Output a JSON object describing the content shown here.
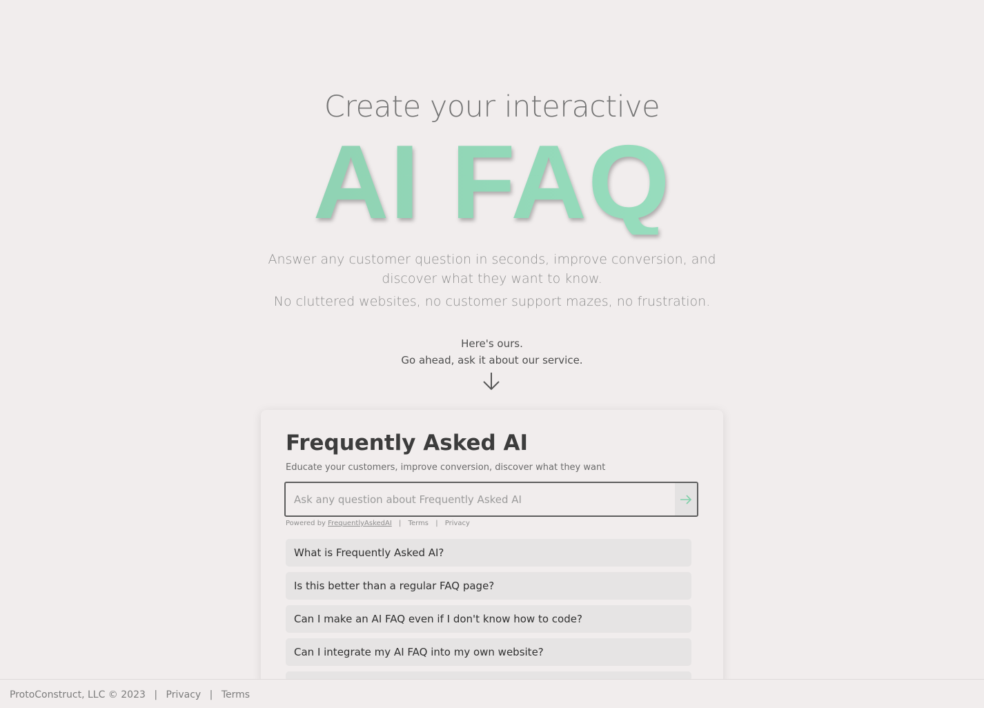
{
  "hero": {
    "lead": "Create your interactive",
    "title": "AI FAQ",
    "description": "Answer any customer question in seconds, improve conversion, and discover what they want to know.",
    "description2": "No cluttered websites, no customer support mazes, no frustration.",
    "ours_line1": "Here's ours.",
    "ours_line2": "Go ahead, ask it about our service.",
    "arrow_icon": "arrow-down-icon"
  },
  "faq_widget": {
    "title": "Frequently Asked AI",
    "subtitle": "Educate your customers, improve conversion, discover what they want",
    "input_placeholder": "Ask any question about Frequently Asked AI",
    "input_value": "",
    "submit_icon": "arrow-right-icon",
    "powered_prefix": "Powered by",
    "powered_link": "FrequentlyAskedAI",
    "terms_label": "Terms",
    "privacy_label": "Privacy",
    "questions": [
      "What is Frequently Asked AI?",
      "Is this better than a regular FAQ page?",
      "Can I make an AI FAQ even if I don't know how to code?",
      "Can I integrate my AI FAQ into my own website?"
    ]
  },
  "footer": {
    "copyright": "ProtoConstruct, LLC © 2023",
    "privacy_label": "Privacy",
    "terms_label": "Terms"
  },
  "colors": {
    "background": "#f1eded",
    "accent_green": "#93d9b9",
    "text_dark": "#3c3c3c"
  }
}
